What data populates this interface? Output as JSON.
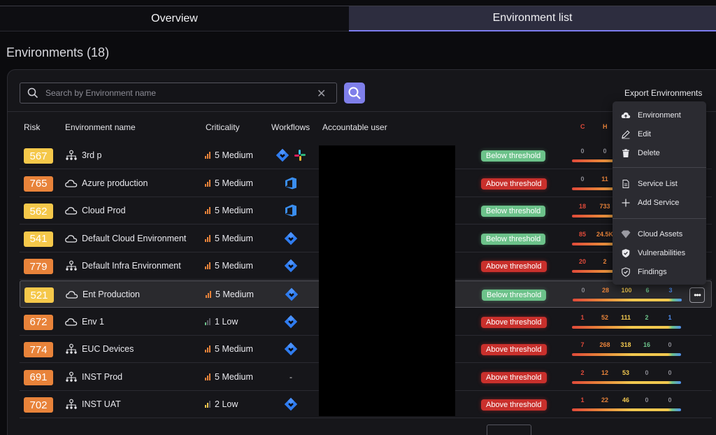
{
  "tabs": [
    {
      "label": "Overview",
      "active": false
    },
    {
      "label": "Environment list",
      "active": true
    }
  ],
  "page_title": "Environments (18)",
  "search": {
    "placeholder": "Search by Environment name",
    "value": ""
  },
  "export_label": "Export Environments",
  "columns": {
    "risk": "Risk",
    "name": "Environment name",
    "criticality": "Criticality",
    "workflows": "Workflows",
    "user": "Accountable user",
    "sev_c": "C",
    "sev_h": "H"
  },
  "rows": [
    {
      "risk": "567",
      "risk_color": "#f5c84a",
      "type": "infra",
      "name": "3rd p",
      "crit_num": "5",
      "crit_label": "Medium",
      "crit_level": 3,
      "workflows": [
        "jira-icon",
        "slack-icon"
      ],
      "status": "Below threshold",
      "status_kind": "below",
      "counts": [
        "0",
        "0",
        "",
        "",
        ""
      ],
      "highlight": false
    },
    {
      "risk": "765",
      "risk_color": "#e8833a",
      "type": "cloud",
      "name": "Azure production",
      "crit_num": "5",
      "crit_label": "Medium",
      "crit_level": 3,
      "workflows": [
        "azure-devops-icon"
      ],
      "status": "Above threshold",
      "status_kind": "above",
      "counts": [
        "0",
        "11",
        "",
        "",
        ""
      ],
      "highlight": false
    },
    {
      "risk": "562",
      "risk_color": "#f5c84a",
      "type": "cloud",
      "name": "Cloud Prod",
      "crit_num": "5",
      "crit_label": "Medium",
      "crit_level": 3,
      "workflows": [
        "azure-devops-icon"
      ],
      "status": "Below threshold",
      "status_kind": "below",
      "counts": [
        "18",
        "733",
        "",
        "",
        ""
      ],
      "highlight": false
    },
    {
      "risk": "541",
      "risk_color": "#f5c84a",
      "type": "cloud",
      "name": "Default Cloud Environment",
      "crit_num": "5",
      "crit_label": "Medium",
      "crit_level": 3,
      "workflows": [
        "jira-icon"
      ],
      "status": "Below threshold",
      "status_kind": "below",
      "counts": [
        "85",
        "24.5K",
        "",
        "",
        ""
      ],
      "highlight": false
    },
    {
      "risk": "779",
      "risk_color": "#e8833a",
      "type": "infra",
      "name": "Default Infra Environment",
      "crit_num": "5",
      "crit_label": "Medium",
      "crit_level": 3,
      "workflows": [
        "jira-icon"
      ],
      "status": "Above threshold",
      "status_kind": "above",
      "counts": [
        "20",
        "2",
        "",
        "",
        ""
      ],
      "highlight": false
    },
    {
      "risk": "521",
      "risk_color": "#f5c84a",
      "type": "cloud",
      "name": "Ent Production",
      "crit_num": "5",
      "crit_label": "Medium",
      "crit_level": 3,
      "workflows": [
        "jira-icon"
      ],
      "status": "Below threshold",
      "status_kind": "below",
      "counts": [
        "0",
        "28",
        "100",
        "6",
        "3"
      ],
      "highlight": true
    },
    {
      "risk": "672",
      "risk_color": "#e8833a",
      "type": "cloud",
      "name": "Env 1",
      "crit_num": "1",
      "crit_label": "Low",
      "crit_level": 1,
      "workflows": [
        "jira-icon"
      ],
      "status": "Above threshold",
      "status_kind": "above",
      "counts": [
        "1",
        "52",
        "111",
        "2",
        "1"
      ],
      "highlight": false
    },
    {
      "risk": "774",
      "risk_color": "#e8833a",
      "type": "infra",
      "name": "EUC Devices",
      "crit_num": "5",
      "crit_label": "Medium",
      "crit_level": 3,
      "workflows": [
        "jira-icon"
      ],
      "status": "Above threshold",
      "status_kind": "above",
      "counts": [
        "7",
        "268",
        "318",
        "16",
        "0"
      ],
      "highlight": false
    },
    {
      "risk": "691",
      "risk_color": "#e8833a",
      "type": "infra",
      "name": "INST Prod",
      "crit_num": "5",
      "crit_label": "Medium",
      "crit_level": 3,
      "workflows": [
        "-"
      ],
      "status": "Above threshold",
      "status_kind": "above",
      "counts": [
        "2",
        "12",
        "53",
        "0",
        "0"
      ],
      "highlight": false
    },
    {
      "risk": "702",
      "risk_color": "#e8833a",
      "type": "infra",
      "name": "INST UAT",
      "crit_num": "2",
      "crit_label": "Low",
      "crit_level": 2,
      "workflows": [
        "jira-icon"
      ],
      "status": "Above threshold",
      "status_kind": "above",
      "counts": [
        "1",
        "22",
        "46",
        "0",
        "0"
      ],
      "highlight": false
    }
  ],
  "context_menu": {
    "items": [
      {
        "label": "Environment",
        "icon": "cloud-upload-icon"
      },
      {
        "label": "Edit",
        "icon": "pencil-icon"
      },
      {
        "label": "Delete",
        "icon": "trash-icon"
      },
      {
        "label": "Service List",
        "icon": "document-icon"
      },
      {
        "label": "Add Service",
        "icon": "plus-icon"
      },
      {
        "label": "Cloud Assets",
        "icon": "diamond-icon"
      },
      {
        "label": "Vulnerabilities",
        "icon": "shield-filled-icon"
      },
      {
        "label": "Findings",
        "icon": "shield-check-icon"
      }
    ]
  },
  "colors": {
    "accent": "#7f7fea",
    "critical": "#e04a3a",
    "high": "#e8833a",
    "medium": "#f1c84f",
    "low": "#6cc28a",
    "info": "#4f8ff0"
  }
}
